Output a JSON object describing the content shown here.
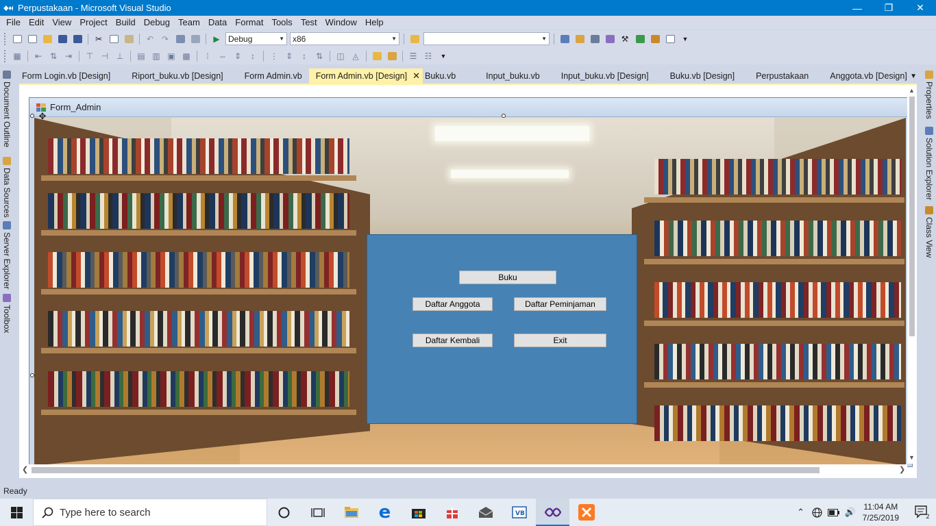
{
  "window": {
    "title": "Perpustakaan - Microsoft Visual Studio"
  },
  "menu": [
    "File",
    "Edit",
    "View",
    "Project",
    "Build",
    "Debug",
    "Team",
    "Data",
    "Format",
    "Tools",
    "Test",
    "Window",
    "Help"
  ],
  "toolbar": {
    "config_value": "Debug",
    "platform_value": "x86",
    "find_value": ""
  },
  "left_rail": [
    "Document Outline",
    "Data Sources",
    "Server Explorer",
    "Toolbox"
  ],
  "right_rail": [
    "Properties",
    "Solution Explorer",
    "Class View"
  ],
  "tabs": [
    {
      "label": "Form Login.vb [Design]"
    },
    {
      "label": "Riport_buku.vb [Design]"
    },
    {
      "label": "Form Admin.vb"
    },
    {
      "label": "Form Admin.vb [Design]",
      "active": true
    },
    {
      "label": "Buku.vb"
    },
    {
      "label": "Input_buku.vb"
    },
    {
      "label": "Input_buku.vb [Design]"
    },
    {
      "label": "Buku.vb [Design]"
    },
    {
      "label": "Perpustakaan"
    },
    {
      "label": "Anggota.vb [Design]"
    }
  ],
  "designer": {
    "form_caption": "Form_Admin",
    "panel_color": "#4682b4",
    "buttons": {
      "buku": "Buku",
      "daftar_anggota": "Daftar Anggota",
      "daftar_peminjaman": "Daftar Peminjaman",
      "daftar_kembali": "Daftar Kembali",
      "exit": "Exit"
    }
  },
  "status": {
    "text": "Ready"
  },
  "taskbar": {
    "search_placeholder": "Type here to search",
    "time": "11:04 AM",
    "date": "7/25/2019",
    "notification_count": "2"
  },
  "colors": {
    "accent": "#007acc",
    "active_tab": "#fff1a8",
    "chrome": "#d6dbe9"
  }
}
